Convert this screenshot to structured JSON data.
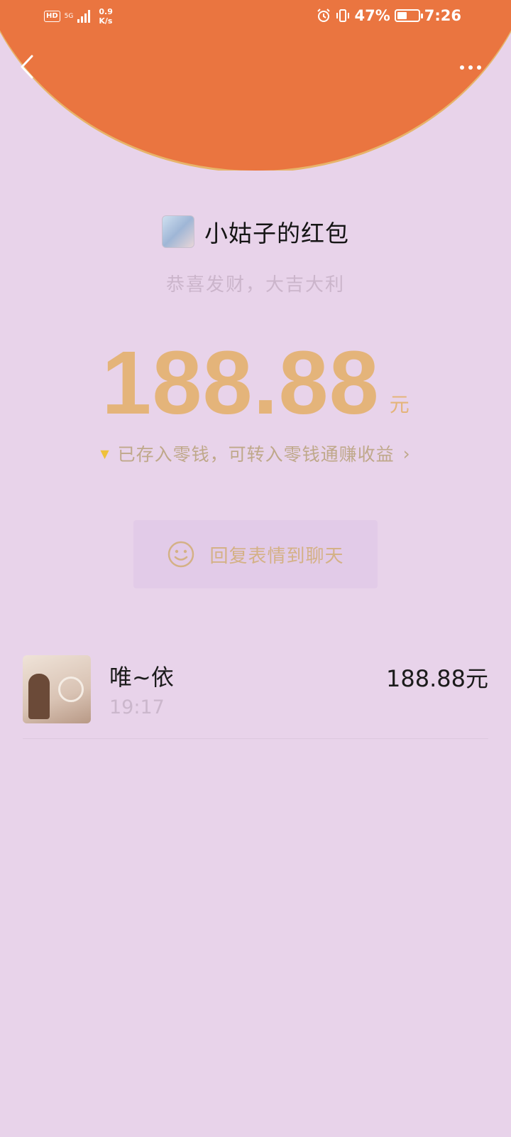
{
  "status_bar": {
    "hd": "HD",
    "network": "5G",
    "speed_value": "0.9",
    "speed_unit": "K/s",
    "battery": "47%",
    "battery_level": 0.47,
    "time": "7:26"
  },
  "header": {
    "back_icon": "chevron-left-icon",
    "more_icon": "more-horizontal-icon",
    "accent_color": "#ea7540"
  },
  "packet": {
    "title": "小姑子的红包",
    "greeting": "恭喜发财，大吉大利",
    "amount": "188.88",
    "unit": "元",
    "change_notice": "已存入零钱，可转入零钱通赚收益",
    "change_chevron": "›",
    "reply_label": "回复表情到聊天"
  },
  "records": [
    {
      "name": "唯~依",
      "time": "19:17",
      "amount": "188.88元"
    }
  ],
  "colors": {
    "background": "#e8d3ea",
    "amount": "#e4b47a"
  }
}
